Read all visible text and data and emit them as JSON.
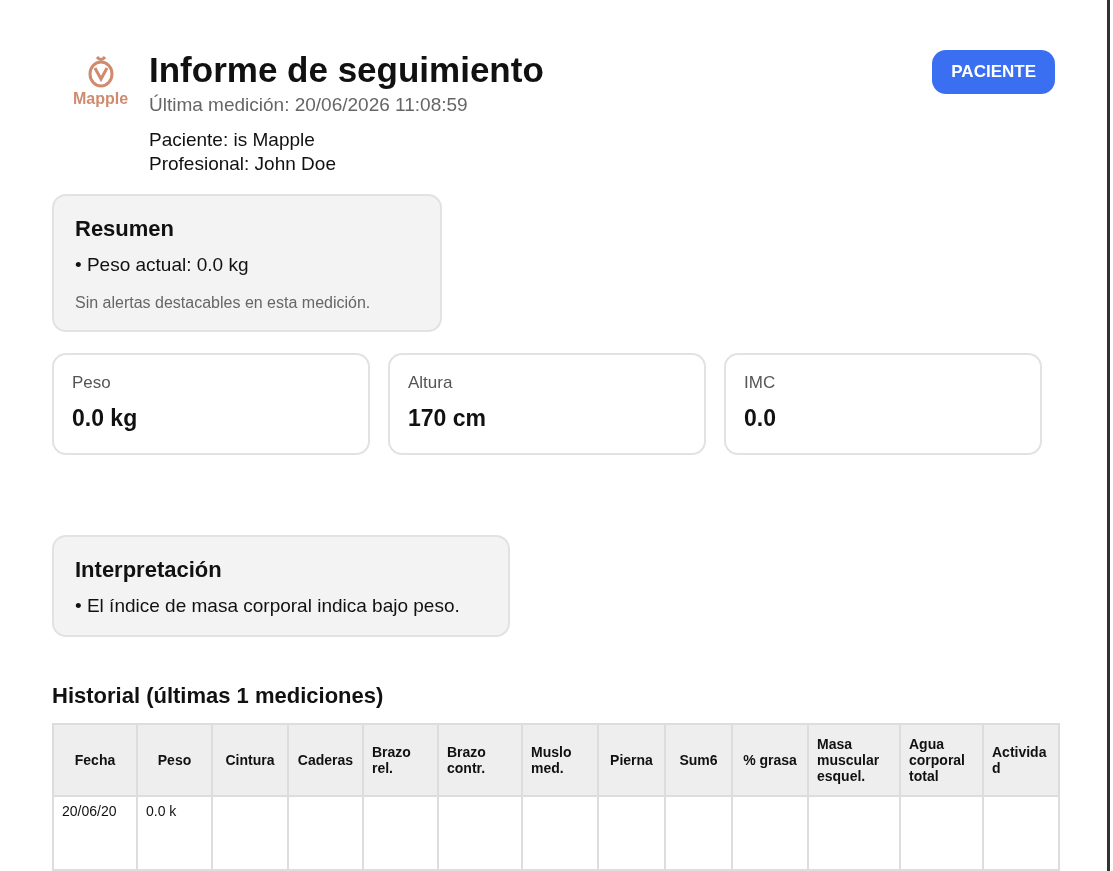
{
  "header": {
    "logo_text": "Mapple",
    "title": "Informe de seguimiento",
    "last_measurement": "Última medición: 20/06/2026 11:08:59",
    "patient": "Paciente: is Mapple",
    "professional": "Profesional: John Doe",
    "button": "PACIENTE"
  },
  "summary": {
    "title": "Resumen",
    "items": [
      "• Peso actual: 0.0 kg"
    ],
    "note": "Sin alertas destacables en esta medición."
  },
  "stats": [
    {
      "label": "Peso",
      "value": "0.0 kg"
    },
    {
      "label": "Altura",
      "value": "170 cm"
    },
    {
      "label": "IMC",
      "value": "0.0"
    }
  ],
  "interpretation": {
    "title": "Interpretación",
    "items": [
      "• El índice de masa corporal indica bajo peso."
    ]
  },
  "history": {
    "title": "Historial (últimas 1 mediciones)",
    "columns": [
      "Fecha",
      "Peso",
      "Cintura",
      "Caderas",
      "Brazo rel.",
      "Brazo contr.",
      "Muslo med.",
      "Pierna",
      "Sum6",
      "% grasa",
      "Masa muscular esquel.",
      "Agua corporal total",
      "Activida d"
    ],
    "rows": [
      [
        "20/06/20",
        "0.0 k",
        "",
        "",
        "",
        "",
        "",
        "",
        "",
        "",
        "",
        "",
        ""
      ]
    ]
  }
}
